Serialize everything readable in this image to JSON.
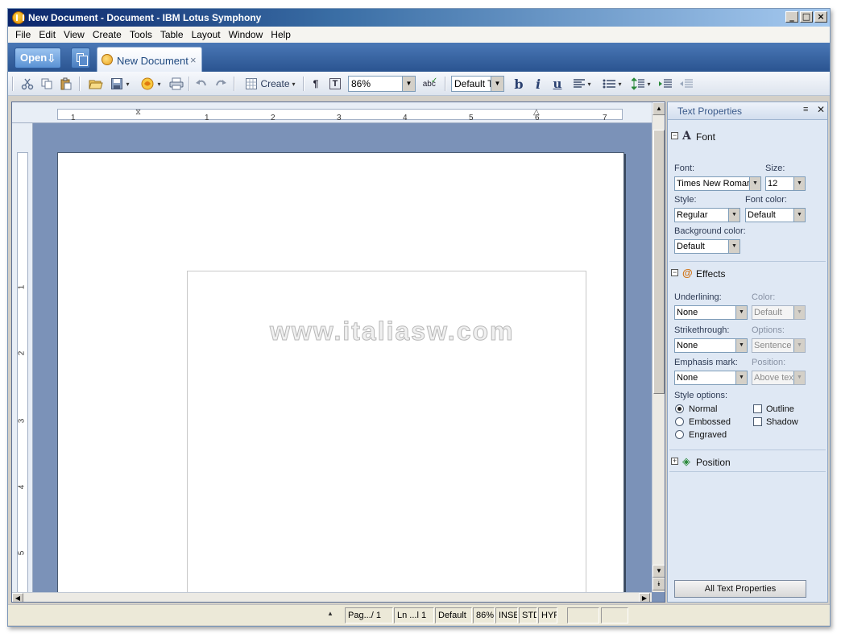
{
  "window": {
    "title": "New Document - Document - IBM Lotus Symphony",
    "controls": [
      "_",
      "□",
      "×"
    ]
  },
  "menu": [
    "File",
    "Edit",
    "View",
    "Create",
    "Tools",
    "Table",
    "Layout",
    "Window",
    "Help"
  ],
  "tabs": {
    "open_label": "Open",
    "document_tab": "New Document",
    "close_glyph": "×"
  },
  "toolbar": {
    "create_label": "Create",
    "zoom_value": "86%",
    "style_value": "Default T",
    "bold": "b",
    "italic": "i",
    "underline": "u",
    "pilcrow": "¶",
    "textbox": "T",
    "spell": "abc"
  },
  "ruler": {
    "horizontal_ticks": [
      "1",
      "1",
      "2",
      "3",
      "4",
      "5",
      "6",
      "7"
    ],
    "vertical_ticks": [
      "1",
      "2",
      "3",
      "4",
      "5"
    ]
  },
  "document": {
    "watermark": "www.italiasw.com"
  },
  "sidebar": {
    "title": "Text Properties",
    "font_section": {
      "label": "Font",
      "font_label": "Font:",
      "font_value": "Times New Roman",
      "size_label": "Size:",
      "size_value": "12",
      "style_label": "Style:",
      "style_value": "Regular",
      "font_color_label": "Font color:",
      "font_color_value": "Default",
      "bg_color_label": "Background color:",
      "bg_color_value": "Default"
    },
    "effects_section": {
      "label": "Effects",
      "underlining_label": "Underlining:",
      "underlining_value": "None",
      "color_label": "Color:",
      "color_value": "Default",
      "strike_label": "Strikethrough:",
      "strike_value": "None",
      "options_label": "Options:",
      "options_value": "Sentence",
      "emphasis_label": "Emphasis mark:",
      "emphasis_value": "None",
      "position_label": "Position:",
      "position_value": "Above text",
      "style_options_label": "Style options:",
      "style_options": [
        "Normal",
        "Embossed",
        "Engraved"
      ],
      "selected_style_option": "Normal",
      "checkbox_options": [
        "Outline",
        "Shadow"
      ]
    },
    "position_section": {
      "label": "Position"
    },
    "all_button": "All Text Properties"
  },
  "statusbar": {
    "page": "Pag.../ 1",
    "line": "Ln ...l 1",
    "style": "Default",
    "zoom": "86%",
    "insert": "INSEI",
    "std": "STD",
    "hyp": "HYP"
  }
}
